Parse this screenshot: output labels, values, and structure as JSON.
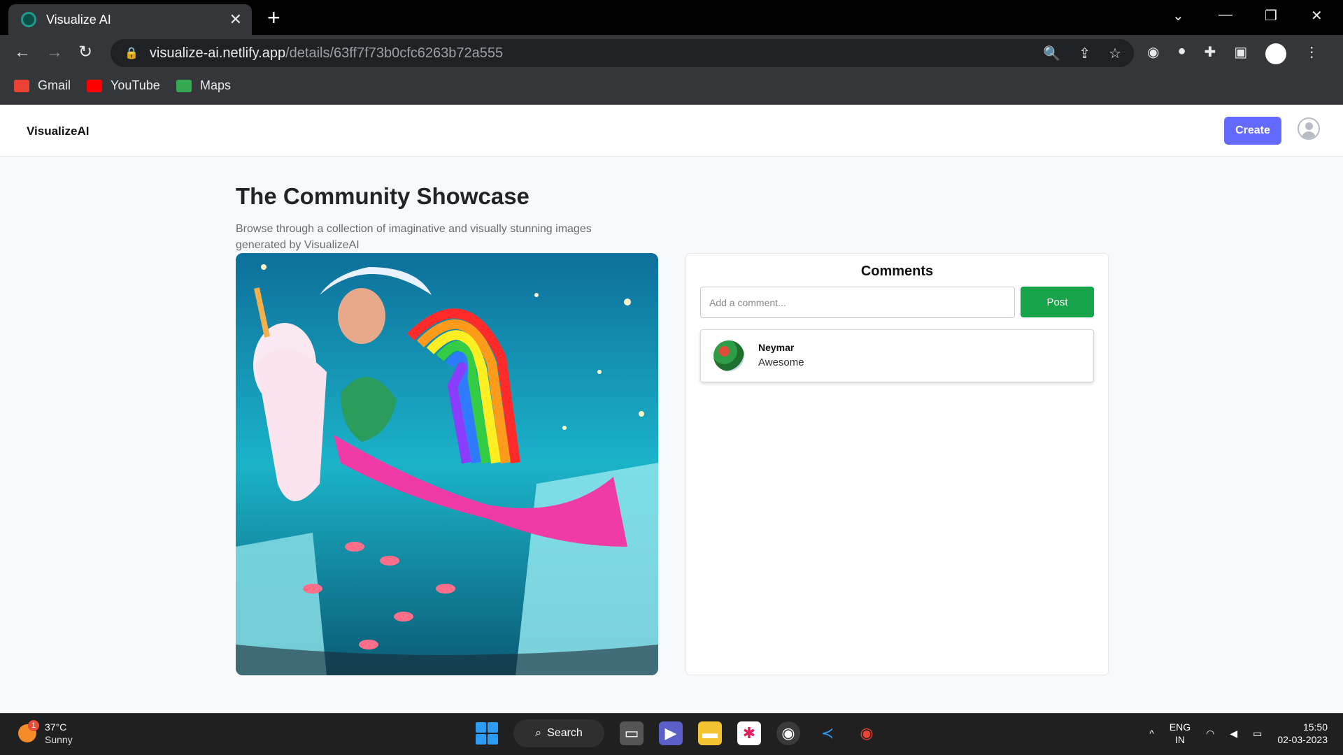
{
  "browser": {
    "tab_title": "Visualize AI",
    "new_tab_label": "+",
    "url_host": "visualize-ai.netlify.app",
    "url_path": "/details/63ff7f73b0cfc6263b72a555",
    "bookmarks": [
      {
        "label": "Gmail",
        "color": "#ea4335"
      },
      {
        "label": "YouTube",
        "color": "#ff0000"
      },
      {
        "label": "Maps",
        "color": "#34a853"
      }
    ]
  },
  "site": {
    "logo": "VisualizeAI",
    "create_label": "Create"
  },
  "showcase": {
    "title": "The Community Showcase",
    "description": "Browse through a collection of imaginative and visually stunning images generated by VisualizeAI"
  },
  "comments": {
    "heading": "Comments",
    "input_placeholder": "Add a comment...",
    "post_label": "Post",
    "items": [
      {
        "author": "Neymar",
        "text": "Awesome"
      }
    ]
  },
  "taskbar": {
    "temperature": "37°C",
    "condition": "Sunny",
    "weather_badge": "1",
    "search_label": "Search",
    "lang_line1": "ENG",
    "lang_line2": "IN",
    "time": "15:50",
    "date": "02-03-2023"
  },
  "colors": {
    "accent": "#6469ff",
    "post": "#16a34a"
  }
}
